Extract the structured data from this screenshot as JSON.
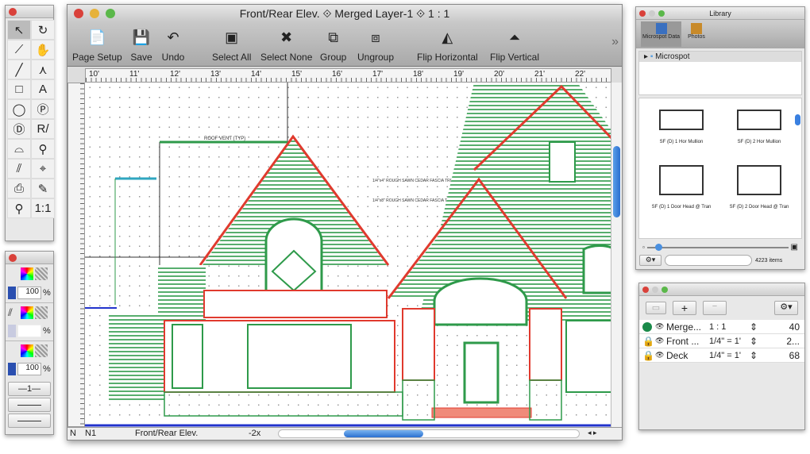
{
  "window": {
    "title": "Front/Rear Elev.  ⟐ Merged Layer-1 ⟐ 1 : 1"
  },
  "toolbar": {
    "items": [
      {
        "label": "Page Setup",
        "icon": "page-setup-icon",
        "glyph": "📄"
      },
      {
        "label": "Save",
        "icon": "save-icon",
        "glyph": "💾"
      },
      {
        "label": "Undo",
        "icon": "undo-icon",
        "glyph": "↶"
      },
      {
        "label": "Select All",
        "icon": "select-all-icon",
        "glyph": "▣"
      },
      {
        "label": "Select None",
        "icon": "select-none-icon",
        "glyph": "✖"
      },
      {
        "label": "Group",
        "icon": "group-icon",
        "glyph": "⧉"
      },
      {
        "label": "Ungroup",
        "icon": "ungroup-icon",
        "glyph": "⧈"
      },
      {
        "label": "Flip Horizontal",
        "icon": "flip-horizontal-icon",
        "glyph": "◭"
      },
      {
        "label": "Flip Vertical",
        "icon": "flip-vertical-icon",
        "glyph": "⏶"
      }
    ],
    "overflow": "»"
  },
  "ruler": {
    "labels": [
      "10'",
      "11'",
      "12'",
      "13'",
      "14'",
      "15'",
      "16'",
      "17'",
      "18'",
      "19'",
      "20'",
      "21'",
      "22'"
    ]
  },
  "drawing_notes": [
    "ROOF VENT (TYP)",
    "1/4\"x4\" ROUGH SAWN CEDAR FASCIA TRIM (TYP)",
    "1/4\"x8\" ROUGH SAWN CEDAR FASCIA TRIM (TYP)"
  ],
  "status": {
    "n": "N",
    "page": "N1",
    "view": "Front/Rear Elev.",
    "zoom": "-2x"
  },
  "tools": [
    "↖",
    "↻",
    "⟋",
    "✋",
    "╱",
    "⋏",
    "□",
    "A",
    "◯",
    "Ⓟ",
    "Ⓓ",
    "R/",
    "⌓",
    "⚲",
    "⫽",
    "⌖",
    "⎙",
    "✎",
    "⚲",
    "1:1"
  ],
  "attributes": {
    "fill_opacity": "100",
    "line_opacity": "",
    "shadow_opacity": "100",
    "percent": "%",
    "line_weight": "—1—"
  },
  "library": {
    "title": "Library",
    "tabs": [
      "Microspot Data",
      "Photos"
    ],
    "tree_item": "Microspot",
    "items": [
      "SF (D) 1 Hor Mullion",
      "SF (D) 2 Hor Mullion",
      "SF (D) 1 Door Head @ Tran",
      "SF (D) 2 Door Head @ Tran"
    ],
    "search_placeholder": "",
    "count": "4223 items"
  },
  "layers": {
    "rows": [
      {
        "name": "Merge...",
        "scale": "1 : 1",
        "count": "40",
        "status": "active"
      },
      {
        "name": "Front ...",
        "scale": "1/4\" = 1'",
        "count": "2...",
        "status": "locked"
      },
      {
        "name": "Deck",
        "scale": "1/4\" = 1'",
        "count": "68",
        "status": "locked"
      }
    ],
    "add": "+",
    "remove": "−"
  },
  "colors": {
    "siding": "#2e9a4a",
    "trim": "#e03a2e",
    "guide": "#2233cc"
  }
}
